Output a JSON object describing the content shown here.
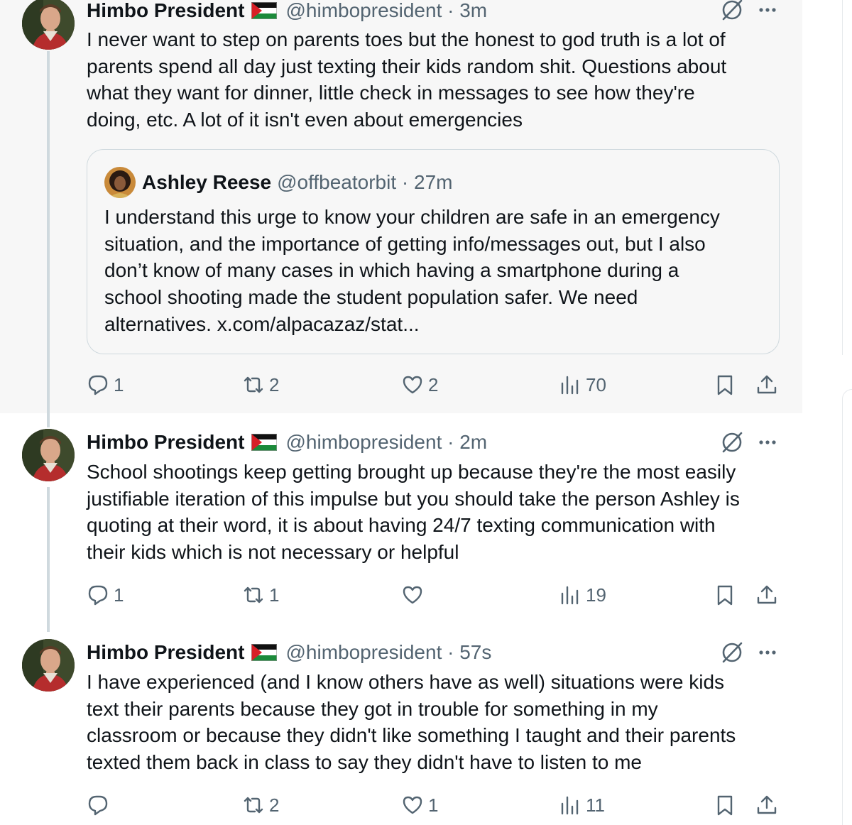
{
  "colors": {
    "text_primary": "#0f1419",
    "text_secondary": "#536471",
    "thread_line": "#cfd9de",
    "highlight_bg": "#f7f7f7"
  },
  "tweets": [
    {
      "name": "Himbo President",
      "flag_icon": "palestine-flag-icon",
      "handle_time": "@himbopresident · 3m",
      "lines": [
        "I never want to step on parents toes but the honest to god truth is a lot of",
        "parents spend all day just texting their kids random shit. Questions about",
        "what they want for dinner, little check in messages to see how they're",
        "doing, etc. A lot of it isn't even about emergencies"
      ],
      "quote": {
        "name": "Ashley Reese",
        "handle_time": "@offbeatorbit · 27m",
        "lines": [
          "I understand this urge to know your children are safe in an emergency",
          "situation, and the importance of getting info/messages out, but I also",
          "don’t know of many cases in which having a smartphone during a",
          "school shooting made the student population safer. We need",
          "alternatives. x.com/alpacazaz/stat..."
        ]
      },
      "replies": "1",
      "reposts": "2",
      "likes": "2",
      "views": "70"
    },
    {
      "name": "Himbo President",
      "flag_icon": "palestine-flag-icon",
      "handle_time": "@himbopresident · 2m",
      "lines": [
        "School shootings keep getting brought up because they're the most easily",
        "justifiable iteration of this impulse but you should take the person Ashley is",
        "quoting at their word, it is about having 24/7 texting communication with",
        "their kids which is not necessary or helpful"
      ],
      "replies": "1",
      "reposts": "1",
      "likes": "",
      "views": "19"
    },
    {
      "name": "Himbo President",
      "flag_icon": "palestine-flag-icon",
      "handle_time": "@himbopresident · 57s",
      "lines": [
        "I have experienced (and I know others have as well) situations were kids",
        "text their parents because they got in trouble for something in my",
        "classroom or because they didn't like something I taught and their parents",
        "texted them back in class to say they didn't have to listen to me"
      ],
      "replies": "",
      "reposts": "2",
      "likes": "1",
      "views": "11"
    }
  ],
  "icons": {
    "reply": "reply-icon",
    "repost": "repost-icon",
    "like": "like-icon",
    "views": "views-icon",
    "bookmark": "bookmark-icon",
    "share": "share-icon",
    "grok": "grok-icon",
    "more": "more-icon"
  }
}
